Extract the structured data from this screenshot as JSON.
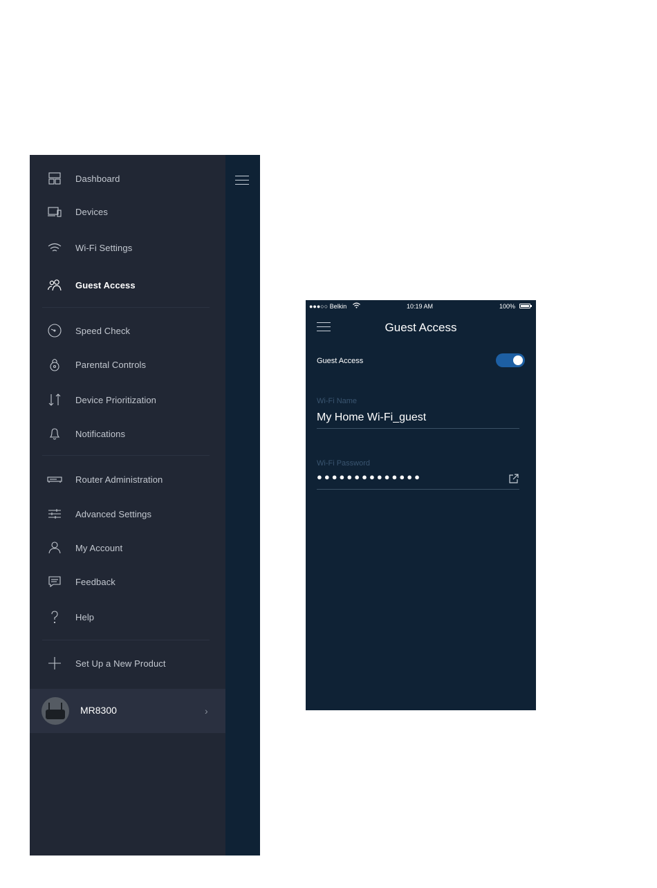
{
  "nav_menu": {
    "items": [
      {
        "label": "Dashboard",
        "icon": "dashboard-icon"
      },
      {
        "label": "Devices",
        "icon": "devices-icon"
      },
      {
        "label": "Wi-Fi Settings",
        "icon": "wifi-icon"
      },
      {
        "label": "Guest Access",
        "icon": "guest-access-icon",
        "active": true
      },
      {
        "label": "Speed Check",
        "icon": "speed-check-icon"
      },
      {
        "label": "Parental Controls",
        "icon": "parental-controls-icon"
      },
      {
        "label": "Device Prioritization",
        "icon": "prioritization-icon"
      },
      {
        "label": "Notifications",
        "icon": "bell-icon"
      },
      {
        "label": "Router Administration",
        "icon": "router-icon"
      },
      {
        "label": "Advanced Settings",
        "icon": "sliders-icon"
      },
      {
        "label": "My Account",
        "icon": "account-icon"
      },
      {
        "label": "Feedback",
        "icon": "feedback-icon"
      },
      {
        "label": "Help",
        "icon": "help-icon"
      },
      {
        "label": "Set Up a New Product",
        "icon": "plus-icon"
      }
    ],
    "device": {
      "name": "MR8300",
      "chevron": "›"
    }
  },
  "phone": {
    "status_bar": {
      "carrier": "●●●○○ Belkin",
      "time": "10:19 AM",
      "battery": "100%"
    },
    "title": "Guest Access",
    "guest_access": {
      "label": "Guest Access",
      "enabled": true
    },
    "wifi_name": {
      "label": "Wi-Fi Name",
      "value": "My Home Wi-Fi_guest"
    },
    "wifi_password": {
      "label": "Wi-Fi Password",
      "value": "●●●●●●●●●●●●●●"
    }
  },
  "colors": {
    "drawer_bg": "#212734",
    "app_bg": "#0f2235",
    "toggle_on": "#1d5fa3"
  }
}
